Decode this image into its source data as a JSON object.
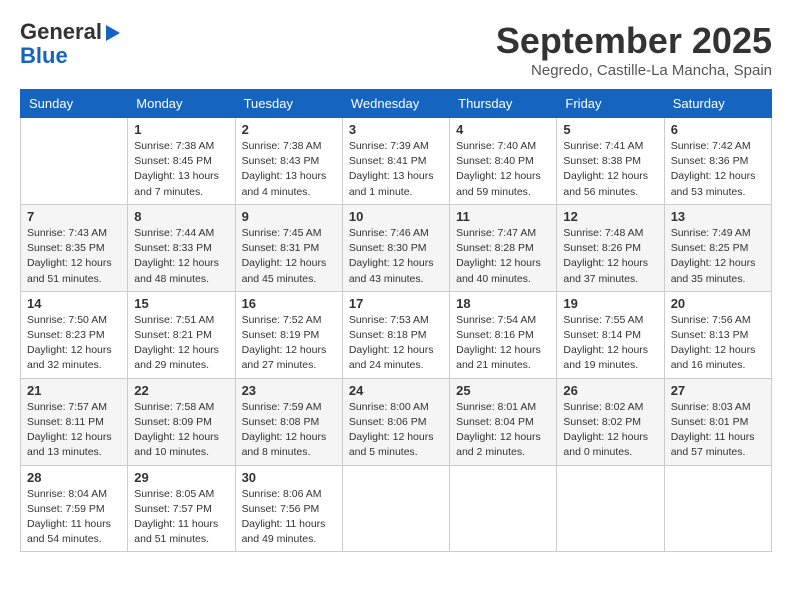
{
  "header": {
    "logo_line1": "General",
    "logo_line2": "Blue",
    "month_title": "September 2025",
    "location": "Negredo, Castille-La Mancha, Spain"
  },
  "days_of_week": [
    "Sunday",
    "Monday",
    "Tuesday",
    "Wednesday",
    "Thursday",
    "Friday",
    "Saturday"
  ],
  "weeks": [
    [
      {
        "day": "",
        "info": ""
      },
      {
        "day": "1",
        "info": "Sunrise: 7:38 AM\nSunset: 8:45 PM\nDaylight: 13 hours\nand 7 minutes."
      },
      {
        "day": "2",
        "info": "Sunrise: 7:38 AM\nSunset: 8:43 PM\nDaylight: 13 hours\nand 4 minutes."
      },
      {
        "day": "3",
        "info": "Sunrise: 7:39 AM\nSunset: 8:41 PM\nDaylight: 13 hours\nand 1 minute."
      },
      {
        "day": "4",
        "info": "Sunrise: 7:40 AM\nSunset: 8:40 PM\nDaylight: 12 hours\nand 59 minutes."
      },
      {
        "day": "5",
        "info": "Sunrise: 7:41 AM\nSunset: 8:38 PM\nDaylight: 12 hours\nand 56 minutes."
      },
      {
        "day": "6",
        "info": "Sunrise: 7:42 AM\nSunset: 8:36 PM\nDaylight: 12 hours\nand 53 minutes."
      }
    ],
    [
      {
        "day": "7",
        "info": "Sunrise: 7:43 AM\nSunset: 8:35 PM\nDaylight: 12 hours\nand 51 minutes."
      },
      {
        "day": "8",
        "info": "Sunrise: 7:44 AM\nSunset: 8:33 PM\nDaylight: 12 hours\nand 48 minutes."
      },
      {
        "day": "9",
        "info": "Sunrise: 7:45 AM\nSunset: 8:31 PM\nDaylight: 12 hours\nand 45 minutes."
      },
      {
        "day": "10",
        "info": "Sunrise: 7:46 AM\nSunset: 8:30 PM\nDaylight: 12 hours\nand 43 minutes."
      },
      {
        "day": "11",
        "info": "Sunrise: 7:47 AM\nSunset: 8:28 PM\nDaylight: 12 hours\nand 40 minutes."
      },
      {
        "day": "12",
        "info": "Sunrise: 7:48 AM\nSunset: 8:26 PM\nDaylight: 12 hours\nand 37 minutes."
      },
      {
        "day": "13",
        "info": "Sunrise: 7:49 AM\nSunset: 8:25 PM\nDaylight: 12 hours\nand 35 minutes."
      }
    ],
    [
      {
        "day": "14",
        "info": "Sunrise: 7:50 AM\nSunset: 8:23 PM\nDaylight: 12 hours\nand 32 minutes."
      },
      {
        "day": "15",
        "info": "Sunrise: 7:51 AM\nSunset: 8:21 PM\nDaylight: 12 hours\nand 29 minutes."
      },
      {
        "day": "16",
        "info": "Sunrise: 7:52 AM\nSunset: 8:19 PM\nDaylight: 12 hours\nand 27 minutes."
      },
      {
        "day": "17",
        "info": "Sunrise: 7:53 AM\nSunset: 8:18 PM\nDaylight: 12 hours\nand 24 minutes."
      },
      {
        "day": "18",
        "info": "Sunrise: 7:54 AM\nSunset: 8:16 PM\nDaylight: 12 hours\nand 21 minutes."
      },
      {
        "day": "19",
        "info": "Sunrise: 7:55 AM\nSunset: 8:14 PM\nDaylight: 12 hours\nand 19 minutes."
      },
      {
        "day": "20",
        "info": "Sunrise: 7:56 AM\nSunset: 8:13 PM\nDaylight: 12 hours\nand 16 minutes."
      }
    ],
    [
      {
        "day": "21",
        "info": "Sunrise: 7:57 AM\nSunset: 8:11 PM\nDaylight: 12 hours\nand 13 minutes."
      },
      {
        "day": "22",
        "info": "Sunrise: 7:58 AM\nSunset: 8:09 PM\nDaylight: 12 hours\nand 10 minutes."
      },
      {
        "day": "23",
        "info": "Sunrise: 7:59 AM\nSunset: 8:08 PM\nDaylight: 12 hours\nand 8 minutes."
      },
      {
        "day": "24",
        "info": "Sunrise: 8:00 AM\nSunset: 8:06 PM\nDaylight: 12 hours\nand 5 minutes."
      },
      {
        "day": "25",
        "info": "Sunrise: 8:01 AM\nSunset: 8:04 PM\nDaylight: 12 hours\nand 2 minutes."
      },
      {
        "day": "26",
        "info": "Sunrise: 8:02 AM\nSunset: 8:02 PM\nDaylight: 12 hours\nand 0 minutes."
      },
      {
        "day": "27",
        "info": "Sunrise: 8:03 AM\nSunset: 8:01 PM\nDaylight: 11 hours\nand 57 minutes."
      }
    ],
    [
      {
        "day": "28",
        "info": "Sunrise: 8:04 AM\nSunset: 7:59 PM\nDaylight: 11 hours\nand 54 minutes."
      },
      {
        "day": "29",
        "info": "Sunrise: 8:05 AM\nSunset: 7:57 PM\nDaylight: 11 hours\nand 51 minutes."
      },
      {
        "day": "30",
        "info": "Sunrise: 8:06 AM\nSunset: 7:56 PM\nDaylight: 11 hours\nand 49 minutes."
      },
      {
        "day": "",
        "info": ""
      },
      {
        "day": "",
        "info": ""
      },
      {
        "day": "",
        "info": ""
      },
      {
        "day": "",
        "info": ""
      }
    ]
  ]
}
